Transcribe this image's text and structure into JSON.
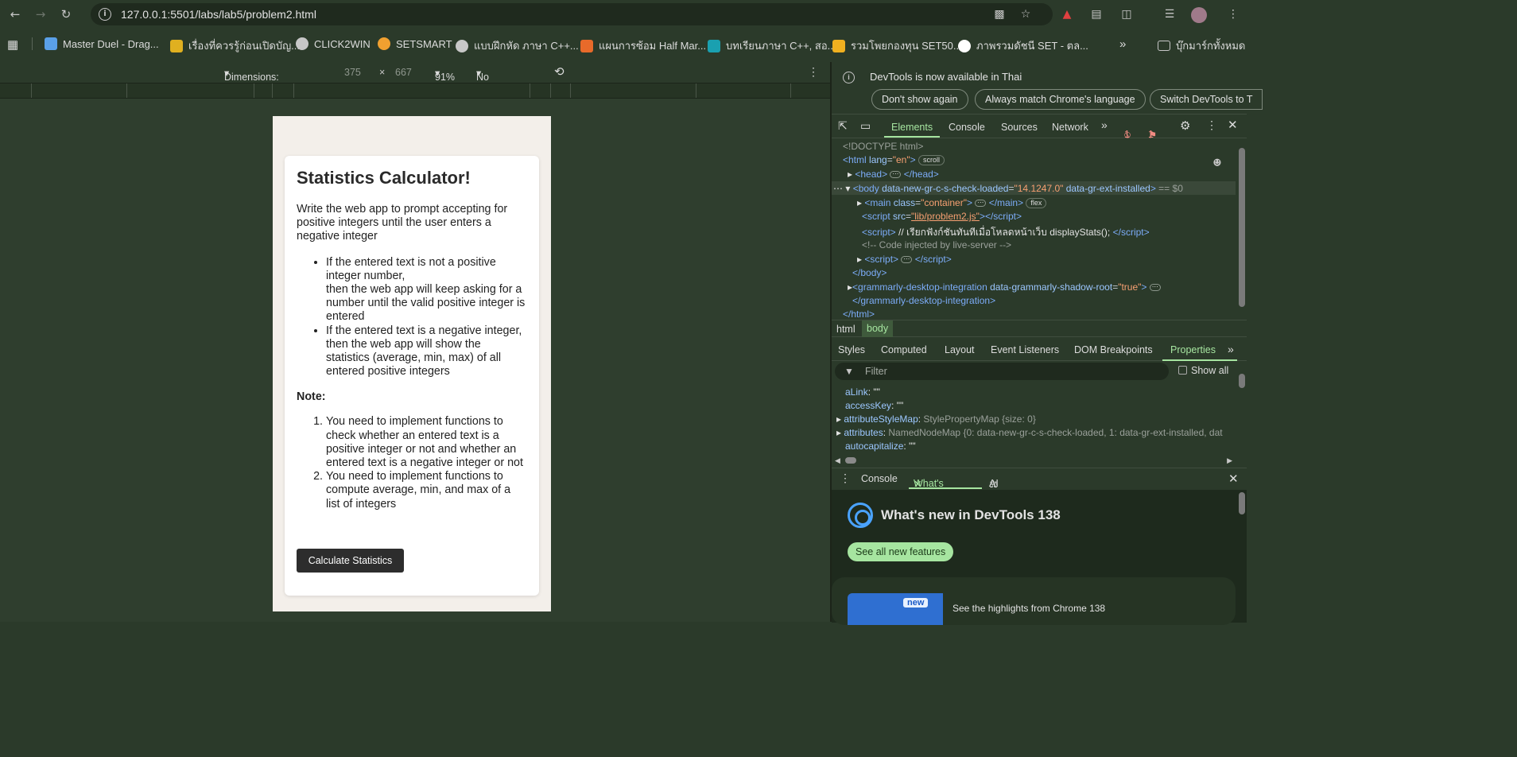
{
  "browser": {
    "url": "127.0.0.1:5501/labs/lab5/problem2.html",
    "bookmarks": [
      {
        "label": "Master Duel - Drag...",
        "color": "#5aa0e8"
      },
      {
        "label": "เรื่องที่ควรรู้ก่อนเปิดบัญ...",
        "color": "#e0b020"
      },
      {
        "label": "CLICK2WIN",
        "color": "#c7c7c7"
      },
      {
        "label": "SETSMART",
        "color": "#f0a030"
      },
      {
        "label": "แบบฝึกหัด ภาษา C++...",
        "color": "#c7c7c7"
      },
      {
        "label": "แผนการซ้อม Half Mar...",
        "color": "#e86a2a"
      },
      {
        "label": "บทเรียนภาษา C++, สอ...",
        "color": "#1aa0b0"
      },
      {
        "label": "รวมโพยกองทุน SET50...",
        "color": "#f0b020"
      },
      {
        "label": "ภาพรวมดัชนี SET - ตล...",
        "color": "#ffffff"
      }
    ],
    "bookmarks_folder": "บุ๊กมาร์กทั้งหมด"
  },
  "device_toolbar": {
    "dimensions_label": "Dimensions: iPhone SE",
    "width": "375",
    "height": "667",
    "zoom": "91%",
    "throttling": "No throttling"
  },
  "page": {
    "title": "Statistics Calculator!",
    "intro": "Write the web app to prompt accepting for positive integers until the user enters a negative integer",
    "bullets": [
      "If the entered text is not a positive integer number,",
      "then the web app will keep asking for a number until the valid positive integer is entered",
      "If the entered text is a negative integer, then the web app will show the statistics (average, min, max) of all entered positive integers"
    ],
    "note_label": "Note:",
    "notes": [
      "You need to implement functions to check whether an entered text is a positive integer or not and whether an entered text is a negative integer or not",
      "You need to implement functions to compute average, min, and max of a list of integers"
    ],
    "button_label": "Calculate Statistics"
  },
  "devtools": {
    "banner_message": "DevTools is now available in Thai",
    "banner_buttons": [
      "Don't show again",
      "Always match Chrome's language",
      "Switch DevTools to T"
    ],
    "tabs": [
      "Elements",
      "Console",
      "Sources",
      "Network"
    ],
    "error_count": "1",
    "warning_count": "1",
    "dom": {
      "doctype": "<!DOCTYPE html>",
      "html_open": "<html",
      "lang_attr": "lang",
      "lang_val": "\"en\"",
      "scroll_badge": "scroll",
      "head": "<head>",
      "head_close": "</head>",
      "body_attr1": "data-new-gr-c-s-check-loaded",
      "body_val1": "\"14.1247.0\"",
      "body_attr2": "data-gr-ext-installed",
      "body_suffix": "== $0",
      "main_class": "\"container\"",
      "flex_badge": "flex",
      "script_src": "\"lib/problem2.js\"",
      "script_inline": "// เรียกฟังก์ชันทันทีเมื่อโหลดหน้าเว็บ displayStats();",
      "comment": "<!-- Code injected by live-server -->",
      "body_close": "</body>",
      "grammarly_attr": "data-grammarly-shadow-root",
      "grammarly_val": "\"true\"",
      "grammarly_close": "</grammarly-desktop-integration>",
      "html_close": "</html>"
    },
    "breadcrumbs": [
      "html",
      "body"
    ],
    "subtabs": [
      "Styles",
      "Computed",
      "Layout",
      "Event Listeners",
      "DOM Breakpoints",
      "Properties"
    ],
    "filter_placeholder": "Filter",
    "show_all_label": "Show all",
    "properties": [
      {
        "key": "aLink",
        "value": "\"\""
      },
      {
        "key": "accessKey",
        "value": "\"\""
      },
      {
        "key": "attributeStyleMap",
        "value": "StylePropertyMap {size: 0}"
      },
      {
        "key": "attributes",
        "value": "NamedNodeMap {0: data-new-gr-c-s-check-loaded, 1: data-gr-ext-installed, dat"
      },
      {
        "key": "autocapitalize",
        "value": "\"\""
      }
    ],
    "drawer_tabs": [
      "Console",
      "What's new",
      "AI assistance"
    ],
    "whats_new_title": "What's new in DevTools 138",
    "whats_new_button": "See all new features",
    "highlight_badge": "new",
    "highlight_text": "See the highlights from Chrome 138"
  }
}
